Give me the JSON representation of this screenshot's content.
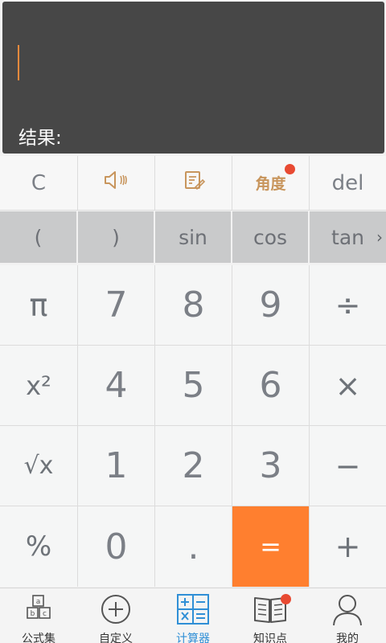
{
  "display": {
    "result_label": "结果:",
    "cursor_color": "#f08a3c"
  },
  "function_row": {
    "clear": "C",
    "voice_icon": "speaker-icon",
    "history_icon": "edit-note-icon",
    "angle": "角度",
    "delete": "del"
  },
  "sci_row": {
    "items": [
      "(",
      ")",
      "sin",
      "cos",
      "tan"
    ],
    "more": "›"
  },
  "keypad": {
    "pi": "π",
    "square": "x²",
    "sqrt": "√x",
    "percent": "%",
    "k7": "7",
    "k8": "8",
    "k9": "9",
    "div": "÷",
    "k4": "4",
    "k5": "5",
    "k6": "6",
    "mul": "×",
    "k1": "1",
    "k2": "2",
    "k3": "3",
    "sub": "−",
    "k0": "0",
    "dot": ".",
    "eq": "=",
    "add": "+"
  },
  "nav": {
    "items": [
      {
        "label": "公式集",
        "icon": "abc-blocks-icon"
      },
      {
        "label": "自定义",
        "icon": "plus-circle-icon"
      },
      {
        "label": "计算器",
        "icon": "calculator-icon"
      },
      {
        "label": "知识点",
        "icon": "book-icon"
      },
      {
        "label": "我的",
        "icon": "person-icon"
      }
    ],
    "active_index": 2,
    "active_color": "#2f8fd6"
  },
  "colors": {
    "accent": "#ff7f2f",
    "badge": "#e84a32",
    "angle_text": "#c8955c"
  }
}
